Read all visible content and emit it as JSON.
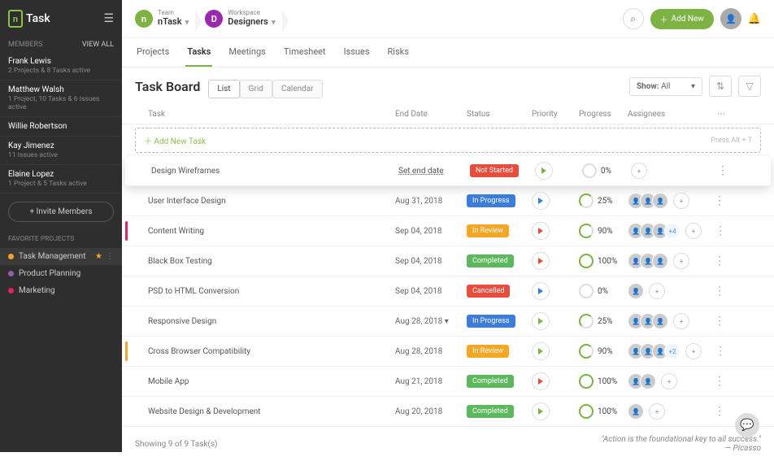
{
  "app_name": "Task",
  "sidebar": {
    "members_label": "MEMBERS",
    "view_all": "View All",
    "members": [
      {
        "name": "Frank Lewis",
        "sub": "2 Projects & 8 Tasks active"
      },
      {
        "name": "Matthew Walsh",
        "sub": "1 Project, 10 Tasks & 6 Issues active"
      },
      {
        "name": "Willie Robertson",
        "sub": ""
      },
      {
        "name": "Kay Jimenez",
        "sub": "11 Issues active"
      },
      {
        "name": "Elaine Lopez",
        "sub": "1 Project & 5 Tasks active"
      }
    ],
    "invite_label": "+ Invite Members",
    "fav_label": "FAVORITE PROJECTS",
    "favs": [
      {
        "name": "Task Management",
        "dot": "#f5a623",
        "active": true,
        "star": true
      },
      {
        "name": "Product Planning",
        "dot": "#9b59b6",
        "active": false,
        "star": false
      },
      {
        "name": "Marketing",
        "dot": "#e91e63",
        "active": false,
        "star": false
      }
    ]
  },
  "crumbs": {
    "team_label": "Team",
    "team_name": "nTask",
    "team_color": "#7cb342",
    "team_letter": "n",
    "ws_label": "Workspace",
    "ws_name": "Designers",
    "ws_color": "#9c27b0",
    "ws_letter": "D"
  },
  "add_new": "Add New",
  "tabs": [
    "Projects",
    "Tasks",
    "Meetings",
    "Timesheet",
    "Issues",
    "Risks"
  ],
  "active_tab": 1,
  "board": {
    "title": "Task Board",
    "views": [
      "List",
      "Grid",
      "Calendar"
    ],
    "active_view": 0,
    "show_label": "Show:",
    "show_value": "All"
  },
  "columns": {
    "task": "Task",
    "end": "End Date",
    "status": "Status",
    "prio": "Priority",
    "prog": "Progress",
    "asg": "Assignees"
  },
  "add_task": {
    "label": "Add New Task",
    "hint": "Press Alt + T"
  },
  "statuses": {
    "not_started": {
      "label": "Not Started",
      "color": "#e74c3c"
    },
    "in_progress": {
      "label": "In Progress",
      "color": "#3b7ddd"
    },
    "in_review": {
      "label": "In Review",
      "color": "#f5a623"
    },
    "completed": {
      "label": "Completed",
      "color": "#5cb85c"
    },
    "cancelled": {
      "label": "Cancelled",
      "color": "#e74c3c"
    }
  },
  "tasks": [
    {
      "name": "Design Wireframes",
      "end": "Set end date",
      "end_link": true,
      "status": "not_started",
      "prio": "green",
      "progress": "0%",
      "pct": 0,
      "assignees": 0,
      "extra": null,
      "elevated": true,
      "flag": null
    },
    {
      "name": "User Interface Design",
      "end": "Aug 31, 2018",
      "status": "in_progress",
      "prio": "blue",
      "progress": "25%",
      "pct": 25,
      "assignees": 3,
      "extra": null,
      "elevated": false,
      "flag": null
    },
    {
      "name": "Content Writing",
      "end": "Sep 04, 2018",
      "status": "in_review",
      "prio": "red",
      "progress": "90%",
      "pct": 90,
      "assignees": 3,
      "extra": "+4",
      "elevated": false,
      "flag": "#e91e63"
    },
    {
      "name": "Black Box Testing",
      "end": "Sep 04, 2018",
      "status": "completed",
      "prio": "red",
      "progress": "100%",
      "pct": 100,
      "assignees": 3,
      "extra": null,
      "elevated": false,
      "flag": null
    },
    {
      "name": "PSD to HTML Conversion",
      "end": "Sep 04, 2018",
      "status": "cancelled",
      "prio": "blue",
      "progress": "0%",
      "pct": 0,
      "assignees": 1,
      "extra": null,
      "elevated": false,
      "flag": null
    },
    {
      "name": "Responsive Design",
      "end": "Aug 28, 2018 ▾",
      "status": "in_progress",
      "prio": "green",
      "progress": "25%",
      "pct": 25,
      "assignees": 3,
      "extra": null,
      "elevated": false,
      "flag": null
    },
    {
      "name": "Cross Browser Compatibility",
      "end": "Aug 28, 2018",
      "status": "in_review",
      "prio": "green",
      "progress": "90%",
      "pct": 90,
      "assignees": 3,
      "extra": "+2",
      "elevated": false,
      "flag": "#f5a623"
    },
    {
      "name": "Mobile App",
      "end": "Aug 21, 2018",
      "status": "completed",
      "prio": "red",
      "progress": "100%",
      "pct": 100,
      "assignees": 2,
      "extra": null,
      "elevated": false,
      "flag": null
    },
    {
      "name": "Website Design & Development",
      "end": "Aug 20, 2018",
      "status": "completed",
      "prio": "green",
      "progress": "100%",
      "pct": 100,
      "assignees": 1,
      "extra": null,
      "elevated": false,
      "flag": null
    }
  ],
  "footer": {
    "count": "Showing 9 of 9 Task(s)",
    "quote": "\"Action is the foundational key to all success.\"",
    "author": "— Picasso"
  }
}
